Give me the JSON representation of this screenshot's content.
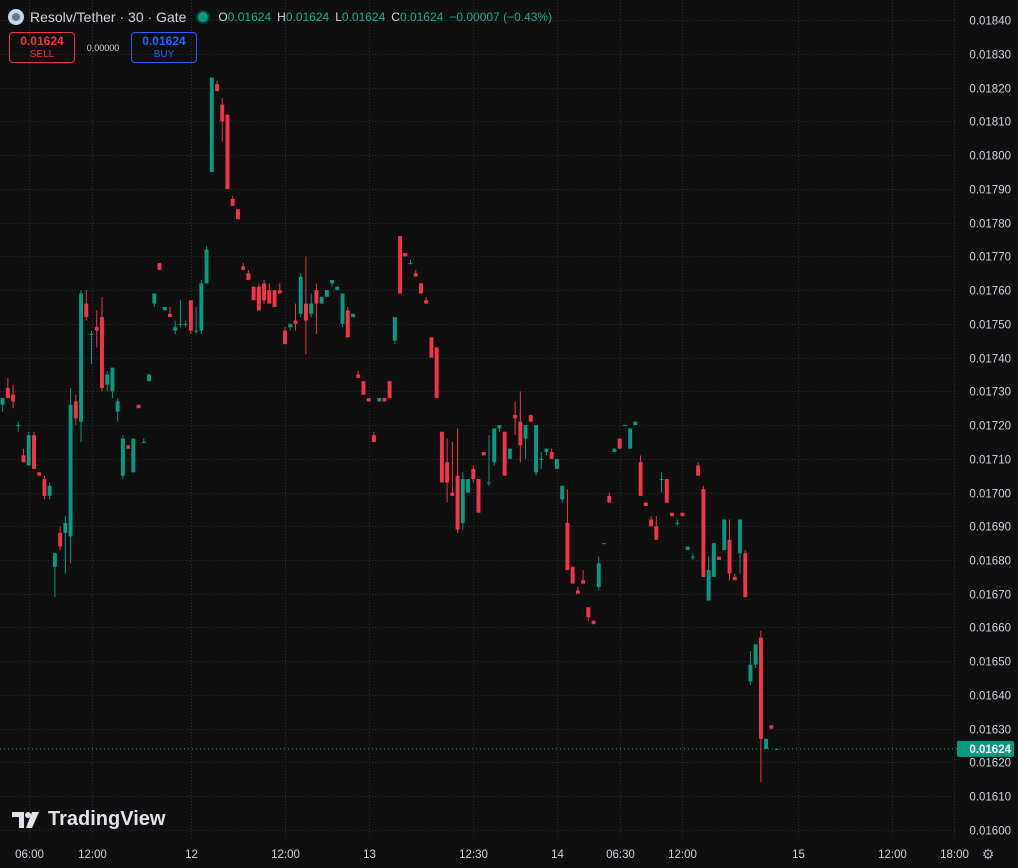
{
  "header": {
    "symbol": "Resolv/Tether · 30 · Gate",
    "o_label": "O",
    "o_value": "0.01624",
    "h_label": "H",
    "h_value": "0.01624",
    "l_label": "L",
    "l_value": "0.01624",
    "c_label": "C",
    "c_value": "0.01624",
    "change": "−0.00007 (−0.43%)"
  },
  "trade": {
    "sell_price": "0.01624",
    "sell_label": "SELL",
    "spread": "0.00000",
    "buy_price": "0.01624",
    "buy_label": "BUY"
  },
  "logo_text": "TradingView",
  "colors": {
    "up": "#089981",
    "down": "#f23645",
    "background": "#0f0f0f",
    "grid": "#2a2e39",
    "axis_text": "#d1d4dc"
  },
  "chart_data": {
    "type": "candlestick",
    "title": "Resolv/Tether · 30 · Gate",
    "y_axis": {
      "position": "right",
      "ylim": [
        0.01597,
        0.01846
      ],
      "ticks": [
        "0.01840",
        "0.01830",
        "0.01820",
        "0.01810",
        "0.01800",
        "0.01790",
        "0.01780",
        "0.01770",
        "0.01760",
        "0.01750",
        "0.01740",
        "0.01730",
        "0.01720",
        "0.01710",
        "0.01700",
        "0.01690",
        "0.01680",
        "0.01670",
        "0.01660",
        "0.01650",
        "0.01640",
        "0.01630",
        "0.01620",
        "0.01610",
        "0.01600"
      ]
    },
    "x_axis": {
      "bar_range": [
        -0.5,
        182.5
      ],
      "ticks": [
        {
          "label": "06:00",
          "bar": 5
        },
        {
          "label": "12:00",
          "bar": 17
        },
        {
          "label": "12",
          "bar": 36
        },
        {
          "label": "12:00",
          "bar": 54
        },
        {
          "label": "13",
          "bar": 70
        },
        {
          "label": "12:30",
          "bar": 90
        },
        {
          "label": "14",
          "bar": 106
        },
        {
          "label": "06:30",
          "bar": 118
        },
        {
          "label": "12:00",
          "bar": 130
        },
        {
          "label": "15",
          "bar": 152
        },
        {
          "label": "12:00",
          "bar": 170
        },
        {
          "label": "18:00",
          "bar": 182
        }
      ]
    },
    "last_price": "0.01624",
    "candles": [
      [
        0.01726,
        0.01728,
        0.01724,
        0.01728
      ],
      [
        0.01731,
        0.01734,
        0.01728,
        0.01728
      ],
      [
        0.01729,
        0.01732,
        0.01725,
        0.01727
      ],
      [
        0.0172,
        0.01721,
        0.01718,
        0.0172
      ],
      [
        0.01711,
        0.01713,
        0.01709,
        0.01709
      ],
      [
        0.01708,
        0.01718,
        0.01708,
        0.01717
      ],
      [
        0.01717,
        0.01718,
        0.01707,
        0.01707
      ],
      [
        0.01706,
        0.01706,
        0.01705,
        0.01705
      ],
      [
        0.01704,
        0.01705,
        0.01698,
        0.01699
      ],
      [
        0.01699,
        0.01703,
        0.01698,
        0.01702
      ],
      [
        0.01678,
        0.01682,
        0.01669,
        0.01682
      ],
      [
        0.01688,
        0.0169,
        0.01683,
        0.01684
      ],
      [
        0.01688,
        0.01693,
        0.01676,
        0.01691
      ],
      [
        0.01687,
        0.01731,
        0.01679,
        0.01726
      ],
      [
        0.01727,
        0.01729,
        0.0172,
        0.01722
      ],
      [
        0.01721,
        0.0176,
        0.01715,
        0.01759
      ],
      [
        0.01756,
        0.0176,
        0.01751,
        0.01752
      ],
      [
        0.01747,
        0.01748,
        0.01738,
        0.01747
      ],
      [
        0.01749,
        0.01754,
        0.01743,
        0.01748
      ],
      [
        0.01752,
        0.01758,
        0.0173,
        0.01731
      ],
      [
        0.01732,
        0.01736,
        0.0173,
        0.01735
      ],
      [
        0.0173,
        0.01737,
        0.01728,
        0.01737
      ],
      [
        0.01724,
        0.01728,
        0.01721,
        0.01727
      ],
      [
        0.01705,
        0.01717,
        0.01704,
        0.01716
      ],
      [
        0.01714,
        0.01714,
        0.01713,
        0.01713
      ],
      [
        0.01706,
        0.01716,
        0.01706,
        0.01716
      ],
      [
        0.01726,
        0.01726,
        0.01725,
        0.01725
      ],
      [
        0.01715,
        0.01716,
        0.01715,
        0.01715
      ],
      [
        0.01733,
        0.01735,
        0.01733,
        0.01735
      ],
      [
        0.01756,
        0.01759,
        0.01755,
        0.01759
      ],
      [
        0.01768,
        0.01768,
        0.01766,
        0.01766
      ],
      [
        0.01754,
        0.01755,
        0.01754,
        0.01755
      ],
      [
        0.01753,
        0.01755,
        0.01752,
        0.01752
      ],
      [
        0.01748,
        0.01751,
        0.01747,
        0.01749
      ],
      [
        0.0175,
        0.01757,
        0.01749,
        0.0175
      ],
      [
        0.0175,
        0.01751,
        0.01749,
        0.0175
      ],
      [
        0.01757,
        0.01757,
        0.01747,
        0.01748
      ],
      [
        0.01748,
        0.01755,
        0.01747,
        0.01748
      ],
      [
        0.01748,
        0.01763,
        0.01747,
        0.01762
      ],
      [
        0.01762,
        0.01773,
        0.01762,
        0.01772
      ],
      [
        0.01795,
        0.01823,
        0.01795,
        0.01823
      ],
      [
        0.01821,
        0.01822,
        0.01819,
        0.01819
      ],
      [
        0.01815,
        0.01817,
        0.01804,
        0.0181
      ],
      [
        0.01812,
        0.01812,
        0.0179,
        0.0179
      ],
      [
        0.01787,
        0.01788,
        0.01785,
        0.01785
      ],
      [
        0.01784,
        0.01784,
        0.01781,
        0.01781
      ],
      [
        0.01767,
        0.01768,
        0.01766,
        0.01766
      ],
      [
        0.01765,
        0.01766,
        0.01763,
        0.01763
      ],
      [
        0.01761,
        0.01761,
        0.01757,
        0.01757
      ],
      [
        0.01761,
        0.01762,
        0.01754,
        0.01754
      ],
      [
        0.01762,
        0.01763,
        0.01756,
        0.01757
      ],
      [
        0.0176,
        0.01762,
        0.01756,
        0.01756
      ],
      [
        0.0176,
        0.0176,
        0.01755,
        0.01755
      ],
      [
        0.0176,
        0.01762,
        0.01759,
        0.01759
      ],
      [
        0.01748,
        0.01749,
        0.01744,
        0.01744
      ],
      [
        0.01749,
        0.0175,
        0.01748,
        0.0175
      ],
      [
        0.01751,
        0.01756,
        0.01748,
        0.0175
      ],
      [
        0.01753,
        0.01765,
        0.01752,
        0.01764
      ],
      [
        0.01756,
        0.0177,
        0.01741,
        0.01751
      ],
      [
        0.01753,
        0.01759,
        0.01752,
        0.01756
      ],
      [
        0.0176,
        0.01762,
        0.01747,
        0.01756
      ],
      [
        0.01756,
        0.01758,
        0.01756,
        0.01758
      ],
      [
        0.01758,
        0.0176,
        0.01758,
        0.0176
      ],
      [
        0.01762,
        0.01763,
        0.01761,
        0.01763
      ],
      [
        0.0176,
        0.01761,
        0.0176,
        0.01761
      ],
      [
        0.0175,
        0.01759,
        0.01749,
        0.01759
      ],
      [
        0.01754,
        0.01755,
        0.01746,
        0.01746
      ],
      [
        0.01752,
        0.01753,
        0.01752,
        0.01753
      ],
      [
        0.01735,
        0.01736,
        0.01734,
        0.01734
      ],
      [
        0.01733,
        0.01733,
        0.01729,
        0.01729
      ],
      [
        0.01728,
        0.01728,
        0.01727,
        0.01727
      ],
      [
        0.01717,
        0.01718,
        0.01715,
        0.01715
      ],
      [
        0.01727,
        0.01728,
        0.01727,
        0.01728
      ],
      [
        0.01728,
        0.01728,
        0.01727,
        0.01727
      ],
      [
        0.01733,
        0.01733,
        0.01728,
        0.01728
      ],
      [
        0.01745,
        0.01752,
        0.01744,
        0.01752
      ],
      [
        0.01776,
        0.01776,
        0.01759,
        0.01759
      ],
      [
        0.01771,
        0.01771,
        0.0177,
        0.0177
      ],
      [
        0.01768,
        0.01769,
        0.01768,
        0.01768
      ],
      [
        0.01765,
        0.01766,
        0.01764,
        0.01764
      ],
      [
        0.01762,
        0.01762,
        0.01759,
        0.01759
      ],
      [
        0.01757,
        0.01758,
        0.01756,
        0.01756
      ],
      [
        0.01746,
        0.01746,
        0.0174,
        0.0174
      ],
      [
        0.01743,
        0.01743,
        0.01728,
        0.01728
      ],
      [
        0.01718,
        0.01718,
        0.01703,
        0.01703
      ],
      [
        0.01709,
        0.01716,
        0.01697,
        0.01703
      ],
      [
        0.017,
        0.01715,
        0.01699,
        0.01699
      ],
      [
        0.01705,
        0.01719,
        0.01688,
        0.01689
      ],
      [
        0.01691,
        0.01706,
        0.01689,
        0.01704
      ],
      [
        0.017,
        0.01704,
        0.017,
        0.01704
      ],
      [
        0.01707,
        0.01708,
        0.01703,
        0.01704
      ],
      [
        0.01704,
        0.01704,
        0.01694,
        0.01694
      ],
      [
        0.01712,
        0.01712,
        0.01711,
        0.01711
      ],
      [
        0.01703,
        0.01717,
        0.01702,
        0.01703
      ],
      [
        0.01709,
        0.01719,
        0.01708,
        0.01719
      ],
      [
        0.01719,
        0.0172,
        0.01718,
        0.0172
      ],
      [
        0.01718,
        0.01718,
        0.01705,
        0.01705
      ],
      [
        0.0171,
        0.01713,
        0.0171,
        0.01713
      ],
      [
        0.01723,
        0.01727,
        0.01717,
        0.01722
      ],
      [
        0.01721,
        0.0173,
        0.01709,
        0.01714
      ],
      [
        0.01716,
        0.0172,
        0.0171,
        0.0172
      ],
      [
        0.01723,
        0.01723,
        0.01721,
        0.01721
      ],
      [
        0.01706,
        0.0172,
        0.01705,
        0.0172
      ],
      [
        0.0171,
        0.01712,
        0.01707,
        0.0171
      ],
      [
        0.01712,
        0.01713,
        0.01711,
        0.01713
      ],
      [
        0.01712,
        0.01713,
        0.0171,
        0.0171
      ],
      [
        0.01707,
        0.0171,
        0.01707,
        0.0171
      ],
      [
        0.01698,
        0.01702,
        0.01697,
        0.01702
      ],
      [
        0.01691,
        0.01701,
        0.01677,
        0.01677
      ],
      [
        0.01678,
        0.01678,
        0.01673,
        0.01673
      ],
      [
        0.01671,
        0.01672,
        0.0167,
        0.0167
      ],
      [
        0.01674,
        0.01677,
        0.01673,
        0.01673
      ],
      [
        0.01666,
        0.01666,
        0.01662,
        0.01663
      ],
      [
        0.01662,
        0.01662,
        0.01661,
        0.01661
      ],
      [
        0.01672,
        0.01681,
        0.01671,
        0.01679
      ],
      [
        0.01685,
        0.01685,
        0.01685,
        0.01685
      ],
      [
        0.01699,
        0.017,
        0.01697,
        0.01697
      ],
      [
        0.01712,
        0.01713,
        0.01712,
        0.01713
      ],
      [
        0.01716,
        0.01716,
        0.01713,
        0.01713
      ],
      [
        0.0172,
        0.0172,
        0.0172,
        0.0172
      ],
      [
        0.01713,
        0.01719,
        0.01713,
        0.01719
      ],
      [
        0.0172,
        0.01721,
        0.0172,
        0.01721
      ],
      [
        0.01709,
        0.01711,
        0.01699,
        0.01699
      ],
      [
        0.01697,
        0.01697,
        0.01696,
        0.01696
      ],
      [
        0.01692,
        0.01693,
        0.0169,
        0.0169
      ],
      [
        0.0169,
        0.01693,
        0.01686,
        0.01686
      ],
      [
        0.01704,
        0.01706,
        0.017,
        0.01704
      ],
      [
        0.01704,
        0.01704,
        0.01697,
        0.01697
      ],
      [
        0.01694,
        0.01694,
        0.01693,
        0.01693
      ],
      [
        0.01691,
        0.01692,
        0.0169,
        0.01691
      ],
      [
        0.01694,
        0.01694,
        0.01693,
        0.01693
      ],
      [
        0.01683,
        0.01684,
        0.01683,
        0.01684
      ],
      [
        0.01681,
        0.01682,
        0.0168,
        0.01681
      ],
      [
        0.01708,
        0.01709,
        0.01705,
        0.01705
      ],
      [
        0.01701,
        0.01702,
        0.01675,
        0.01675
      ],
      [
        0.01668,
        0.01681,
        0.01668,
        0.01677
      ],
      [
        0.01675,
        0.01685,
        0.01675,
        0.01685
      ],
      [
        0.01681,
        0.01681,
        0.0168,
        0.0168
      ],
      [
        0.01683,
        0.01692,
        0.01683,
        0.01692
      ],
      [
        0.01686,
        0.01692,
        0.01674,
        0.01676
      ],
      [
        0.01675,
        0.01676,
        0.01674,
        0.01674
      ],
      [
        0.01682,
        0.01692,
        0.01676,
        0.01692
      ],
      [
        0.01682,
        0.01683,
        0.01669,
        0.01669
      ],
      [
        0.01644,
        0.01653,
        0.01643,
        0.01649
      ],
      [
        0.01649,
        0.01655,
        0.01648,
        0.01655
      ],
      [
        0.01657,
        0.01659,
        0.01614,
        0.01627
      ],
      [
        0.01624,
        0.01627,
        0.01624,
        0.01627
      ],
      [
        0.01631,
        0.01631,
        0.0163,
        0.0163
      ],
      [
        0.01624,
        0.01624,
        0.01624,
        0.01624
      ]
    ]
  }
}
